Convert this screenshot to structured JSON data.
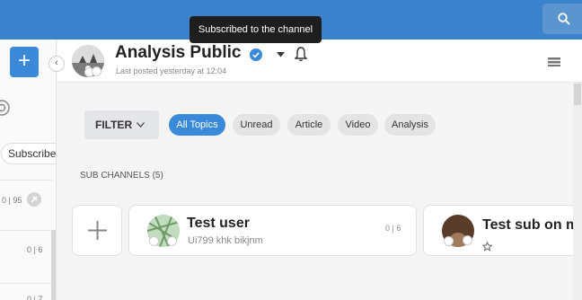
{
  "colors": {
    "topbar": "#3a82cc",
    "accent": "#3a8ad9",
    "verified": "#3a8ad9"
  },
  "tooltip": {
    "text": "Subscribed to the channel"
  },
  "channel": {
    "title": "Analysis Public",
    "last_posted": "Last posted yesterday at 12:04",
    "icons": {
      "verified": "verified-check-icon",
      "dropdown": "caret-down-icon",
      "bell": "bell-icon",
      "menu": "hamburger-icon"
    }
  },
  "left_panel": {
    "chip": "Subscribed",
    "rows": [
      {
        "count_a": "0",
        "count_b": "95"
      },
      {
        "count_a": "0",
        "count_b": "6"
      },
      {
        "count_a": "0",
        "count_b": "7"
      }
    ]
  },
  "filter": {
    "label": "FILTER",
    "topics": [
      "All Topics",
      "Unread",
      "Article",
      "Video",
      "Analysis"
    ],
    "active_topic": "All Topics"
  },
  "sub_channels": {
    "label": "SUB CHANNELS (5)",
    "cards": [
      {
        "name": "Test user",
        "description": "Ui799 khk bikjnm",
        "count_a": "0",
        "count_b": "6"
      },
      {
        "name": "Test sub on mobile",
        "description": ""
      }
    ]
  }
}
